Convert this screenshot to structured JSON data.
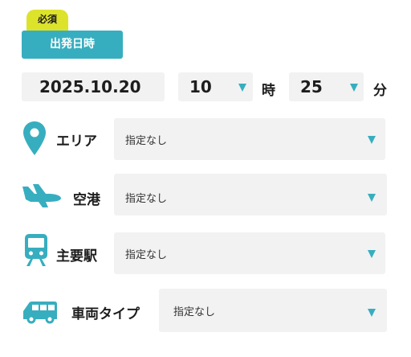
{
  "badge": {
    "required": "必須"
  },
  "section": {
    "title": "出発日時"
  },
  "datetime": {
    "date": "2025.10.20",
    "hour": "10",
    "hour_unit": "時",
    "minute": "25",
    "minute_unit": "分"
  },
  "filters": [
    {
      "label": "エリア",
      "icon": "map-pin-icon",
      "value": "指定なし"
    },
    {
      "label": "空港",
      "icon": "airplane-icon",
      "value": "指定なし"
    },
    {
      "label": "主要駅",
      "icon": "train-icon",
      "value": "指定なし"
    },
    {
      "label": "車両タイプ",
      "icon": "car-icon",
      "value": "指定なし"
    }
  ],
  "colors": {
    "accent": "#37aebf",
    "badge": "#dde32a",
    "field_bg": "#f2f2f2"
  }
}
